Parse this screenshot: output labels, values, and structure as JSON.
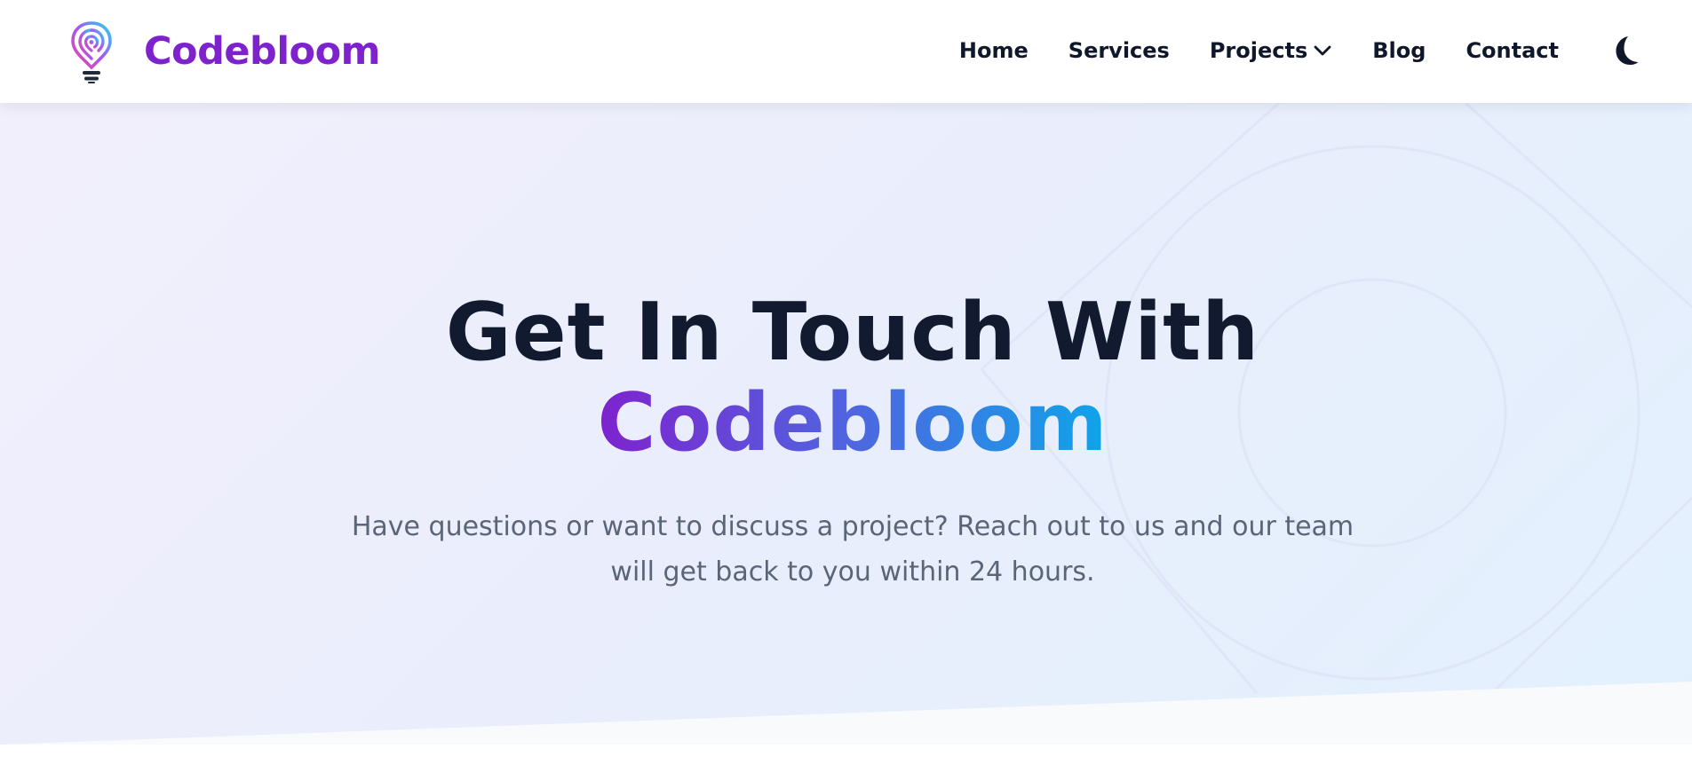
{
  "brand": {
    "name": "Codebloom",
    "color": "#7e22ce"
  },
  "nav": {
    "items": [
      {
        "label": "Home"
      },
      {
        "label": "Services"
      },
      {
        "label": "Projects",
        "has_dropdown": true
      },
      {
        "label": "Blog"
      },
      {
        "label": "Contact"
      }
    ],
    "theme_toggle_icon": "moon-icon"
  },
  "hero": {
    "heading_line1": "Get In Touch With",
    "heading_line2": "Codebloom",
    "subtitle_line1": "Have questions or want to discuss a project? Reach out to us and our team",
    "subtitle_line2": "will get back to you within 24 hours.",
    "gradient_colors": [
      "#7e22ce",
      "#4f66e0",
      "#0ea5e9"
    ],
    "heading_color": "#111a2e",
    "subtitle_color": "#5b6578"
  }
}
